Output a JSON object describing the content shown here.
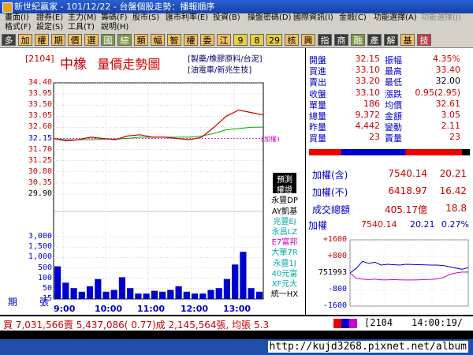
{
  "window": {
    "title": "新世紀贏家 - 101/12/22 - 台盤個股走勢：播報順序"
  },
  "menu": {
    "row1": [
      "畫面(I)",
      "證券(E)",
      "主力(M)",
      "籌碼(F)",
      "股市(S)",
      "匯市利率(E)",
      "投資(B)",
      "操盤密碼(D)",
      "國際資訊(I)",
      "金融(C)",
      "功能選擇(A)",
      "功能選擇(J)"
    ],
    "row2": [
      "格式(F)",
      "設定(S)",
      "工具(T)",
      "說明(H)"
    ]
  },
  "toolbar": {
    "buttons": [
      "多",
      "加",
      "權",
      "期",
      "價",
      "選",
      "國",
      "綜",
      "類",
      "幅",
      "智",
      "權",
      "委",
      "江",
      "9",
      "8",
      "29",
      "核",
      "興",
      "指",
      "商",
      "融",
      "產",
      "解",
      "基",
      "技"
    ]
  },
  "stock": {
    "code": "[2104]",
    "name": "中橡",
    "chart_title": "量價走勢圖",
    "category1": "[製藥/橡膠原料/台泥]",
    "category2": "[油電車/新兆生技]"
  },
  "price_axis": [
    "34.40",
    "33.95",
    "33.50",
    "33.05",
    "32.60",
    "32.15",
    "31.70",
    "31.25",
    "30.80",
    "30.35",
    "29.90"
  ],
  "price_ref_label": "(加權)",
  "volume_axis": [
    "3,000",
    "1,500",
    "1,000",
    "500",
    "100",
    "50",
    "15"
  ],
  "volume_units": {
    "left": "期",
    "right": "張"
  },
  "time_axis": [
    "9:00",
    "10:00",
    "11:00",
    "12:00",
    "13:00"
  ],
  "brokers": {
    "items": [
      {
        "label": "預測",
        "color": "#ffffff",
        "bg": "#000000"
      },
      {
        "label": "權證",
        "color": "#ffffff",
        "bg": "#000000"
      },
      {
        "label": "永豐DP",
        "color": "#000000",
        "bg": "#ffffff"
      },
      {
        "label": "AY凱基",
        "color": "#000000",
        "bg": "#ffffff"
      },
      {
        "label": "兆豐EJ",
        "color": "#00aaaa",
        "bg": "#ffffff"
      },
      {
        "label": "永昌LZ",
        "color": "#00aaaa",
        "bg": "#ffffff"
      },
      {
        "label": "E7富邦",
        "color": "#cc00cc",
        "bg": "#ffffff"
      },
      {
        "label": "大華7R",
        "color": "#00aaaa",
        "bg": "#ffffff"
      },
      {
        "label": "永豐1J",
        "color": "#00aaaa",
        "bg": "#ffffff"
      },
      {
        "label": "40元富",
        "color": "#00aaaa",
        "bg": "#ffffff"
      },
      {
        "label": "XF元大",
        "color": "#00aaaa",
        "bg": "#ffffff"
      },
      {
        "label": "統一HX",
        "color": "#000000",
        "bg": "#ffffff"
      }
    ]
  },
  "quote": {
    "open": {
      "label": "開盤",
      "value": "32.15"
    },
    "amp": {
      "label": "振幅",
      "value": "4.35%"
    },
    "bid": {
      "label": "買進",
      "value": "33.10"
    },
    "high": {
      "label": "最高",
      "value": "33.40"
    },
    "ask": {
      "label": "賣出",
      "value": "33.20"
    },
    "low": {
      "label": "最低",
      "value": "32.00"
    },
    "close": {
      "label": "收盤",
      "value": "33.10"
    },
    "chg": {
      "label": "漲跌",
      "value": "0.95(2.95)"
    },
    "lot": {
      "label": "單量",
      "value": "186"
    },
    "avg": {
      "label": "均價",
      "value": "32.61"
    },
    "tvol": {
      "label": "總量",
      "value": "9,372"
    },
    "amt": {
      "label": "金額",
      "value": "3.05"
    },
    "yvol": {
      "label": "昨量",
      "value": "4,442"
    },
    "vchg": {
      "label": "變動",
      "value": "2.11"
    },
    "buyq": {
      "label": "買量",
      "value": "23"
    },
    "sellq": {
      "label": "賣量",
      "value": "23"
    }
  },
  "index_info": {
    "taiex_incl": {
      "label": "加權(含)",
      "value": "7540.14",
      "chg": "20.21"
    },
    "taiex_excl": {
      "label": "加權(不)",
      "value": "6418.97",
      "chg": "16.42"
    },
    "turnover": {
      "label": "成交總額",
      "value": "405.17億",
      "chg": "18.8"
    }
  },
  "mini_chart": {
    "title": "加權",
    "value": "7540.14",
    "chg": "20.21",
    "pct": "0.27%",
    "axis": [
      "+1600",
      "+800",
      "751993",
      "-800",
      "-1600"
    ]
  },
  "status": {
    "text": "買 7,031,566賣 5,437,086( 0.77)成 2,145,564張, 均張 5.3"
  },
  "status_code": "[2104",
  "status_time": "14:00:19/",
  "watermark": "http://kujd3268.pixnet.net/album",
  "colors": {
    "up": "#cc0000",
    "down": "#008800",
    "text_blue": "#0000cc",
    "window_blue": "#1f4fa8"
  },
  "chart_data": [
    {
      "type": "line",
      "title": "量價走勢圖",
      "x": [
        "9:00",
        "10:00",
        "11:00",
        "12:00",
        "13:00"
      ],
      "ylim": [
        29.9,
        34.4
      ],
      "series": [
        {
          "name": "",
          "values": [
            32.15,
            32.05,
            32.1,
            32.2,
            32.15,
            32.1,
            32.25,
            32.3,
            32.2,
            32.2,
            32.15,
            32.1,
            32.2,
            32.6,
            33.05,
            33.3,
            33.2,
            33.1
          ]
        },
        {
          "name": "",
          "values": [
            32.15,
            32.1,
            32.1,
            32.1,
            32.12,
            32.12,
            32.15,
            32.2,
            32.2,
            32.2,
            32.2,
            32.2,
            32.25,
            32.35,
            32.5,
            32.55,
            32.6,
            32.61
          ]
        }
      ]
    },
    {
      "type": "bar",
      "title": "",
      "x": [
        "9:00",
        "10:00",
        "11:00",
        "12:00",
        "13:00"
      ],
      "ylabel": "張",
      "values": [
        180,
        90,
        60,
        40,
        70,
        110,
        40,
        50,
        120,
        60,
        30,
        30,
        45,
        40,
        50,
        70,
        40,
        30,
        30,
        50,
        60,
        110,
        190,
        260,
        60,
        40
      ]
    },
    {
      "type": "line",
      "title": "加權",
      "ylim": [
        -1600,
        1600
      ],
      "series": [
        {
          "name": "",
          "values": [
            0,
            220,
            560,
            460,
            520,
            380,
            420,
            400,
            380,
            420,
            410,
            400,
            390,
            380,
            380,
            360,
            300,
            240,
            180,
            260
          ]
        },
        {
          "name": "",
          "values": [
            0,
            -260,
            -300,
            -320,
            -300,
            -330,
            -330,
            -320,
            -330,
            -340,
            -340,
            -330,
            -320,
            -310,
            -290,
            -220,
            -80,
            0,
            40,
            40
          ]
        }
      ]
    }
  ]
}
